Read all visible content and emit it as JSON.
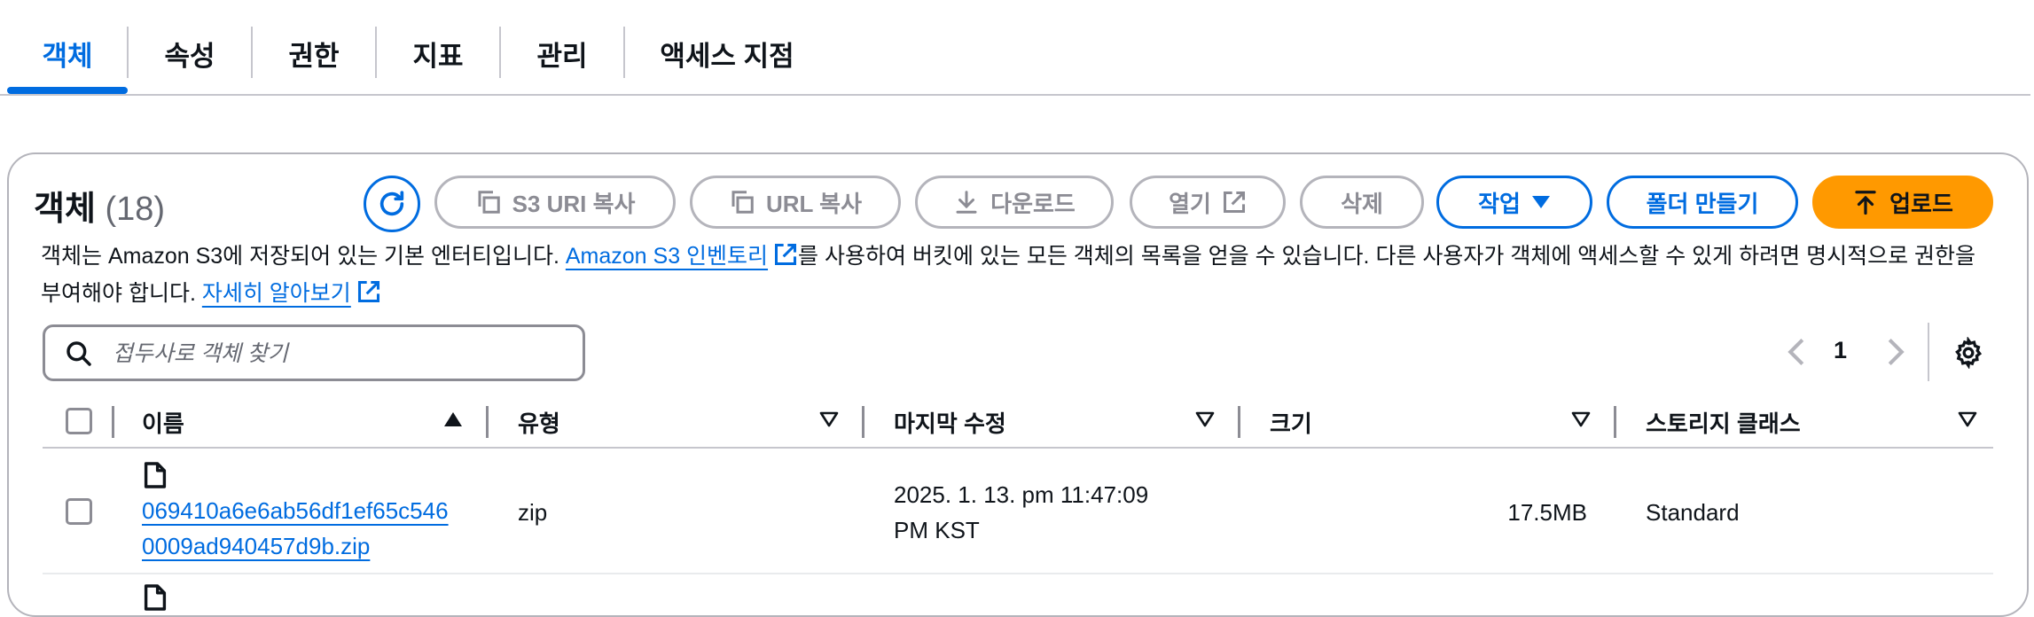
{
  "tabs": [
    {
      "label": "객체",
      "active": true
    },
    {
      "label": "속성"
    },
    {
      "label": "권한"
    },
    {
      "label": "지표"
    },
    {
      "label": "관리"
    },
    {
      "label": "액세스 지점"
    }
  ],
  "objects_panel": {
    "title": "객체",
    "count": "(18)",
    "buttons": {
      "copy_s3_uri": "S3 URI 복사",
      "copy_url": "URL 복사",
      "download": "다운로드",
      "open": "열기",
      "delete": "삭제",
      "actions": "작업",
      "create_folder": "폴더 만들기",
      "upload": "업로드"
    },
    "description": {
      "part1": "객체는 Amazon S3에 저장되어 있는 기본 엔터티입니다. ",
      "inventory_link": "Amazon S3 인벤토리",
      "part2": "를 사용하여 버킷에 있는 모든 객체의 목록을 얻을 수 있습니다. 다른 사용자가 객체에 액세스할 수 있게 하려면 명시적으로 권한을 부여해야 합니다. ",
      "learn_more_link": "자세히 알아보기"
    },
    "search": {
      "placeholder": "접두사로 객체 찾기",
      "value": ""
    },
    "pagination": {
      "current_page": "1"
    }
  },
  "table": {
    "columns": [
      "이름",
      "유형",
      "마지막 수정",
      "크기",
      "스토리지 클래스"
    ],
    "rows": [
      {
        "name": "069410a6e6ab56df1ef65c5460009ad940457d9b.zip",
        "type": "zip",
        "last_modified_line1": "2025. 1. 13. pm 11:47:09",
        "last_modified_line2": "PM KST",
        "size": "17.5MB",
        "storage_class": "Standard"
      }
    ]
  },
  "colors": {
    "accent": "#006ce0",
    "primary_button": "#ff9900",
    "disabled": "#8c8c94",
    "text": "#0f141a"
  },
  "icons": [
    "refresh-icon",
    "copy-icon",
    "download-icon",
    "external-link-icon",
    "caret-down-icon",
    "upload-icon",
    "search-icon",
    "chevron-left-icon",
    "chevron-right-icon",
    "gear-icon",
    "sort-ascending-icon",
    "sort-descending-icon",
    "file-icon"
  ]
}
